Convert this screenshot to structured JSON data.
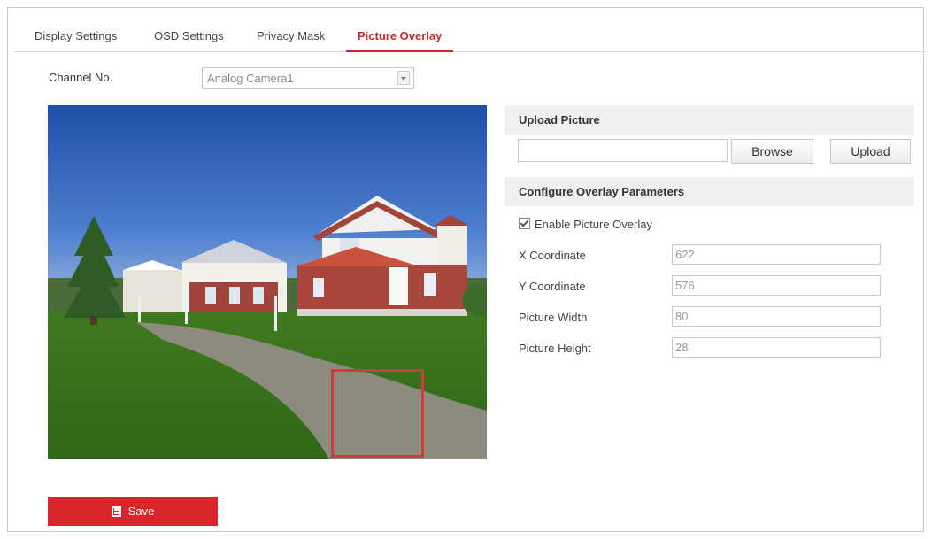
{
  "tabs": [
    {
      "label": "Display Settings",
      "active": false
    },
    {
      "label": "OSD Settings",
      "active": false
    },
    {
      "label": "Privacy Mask",
      "active": false
    },
    {
      "label": "Picture Overlay",
      "active": true
    }
  ],
  "channel": {
    "label": "Channel No.",
    "value": "Analog Camera1"
  },
  "upload": {
    "title": "Upload Picture",
    "file_value": "",
    "browse_label": "Browse",
    "upload_label": "Upload"
  },
  "overlay": {
    "title": "Configure Overlay Parameters",
    "enable_label": "Enable Picture Overlay",
    "enable_checked": true,
    "fields": [
      {
        "label": "X Coordinate",
        "value": "622"
      },
      {
        "label": "Y Coordinate",
        "value": "576"
      },
      {
        "label": "Picture Width",
        "value": "80"
      },
      {
        "label": "Picture Height",
        "value": "28"
      }
    ]
  },
  "save_label": "Save",
  "colors": {
    "accent": "#c8282e",
    "save_bg": "#d9262c",
    "overlay_border": "#d13b3b"
  }
}
